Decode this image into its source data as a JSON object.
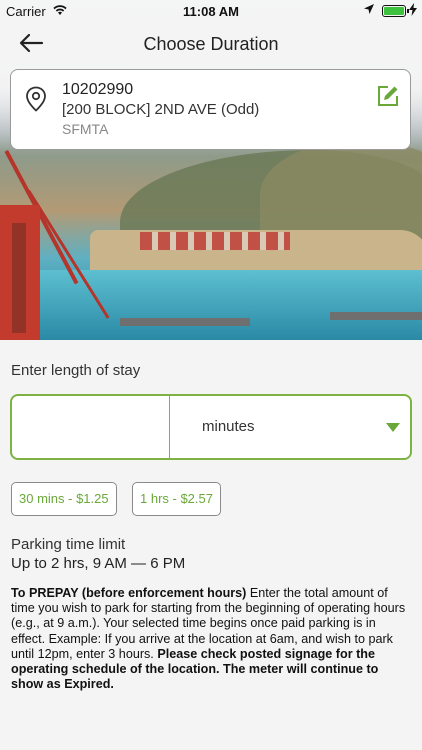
{
  "status_bar": {
    "carrier": "Carrier",
    "time": "11:08 AM",
    "battery_level": 1.0,
    "icons": [
      "wifi-icon",
      "location-arrow-icon",
      "battery-icon",
      "charging-bolt-icon"
    ]
  },
  "nav": {
    "title": "Choose Duration",
    "back_icon": "arrow-left-icon"
  },
  "location": {
    "code": "10202990",
    "address": "[200 BLOCK] 2ND AVE (Odd)",
    "agency": "SFMTA",
    "pin_icon": "map-pin-icon",
    "edit_icon": "edit-icon"
  },
  "duration": {
    "label": "Enter length of stay",
    "value": "",
    "placeholder": "",
    "unit": "minutes",
    "accent": "#7cb342"
  },
  "presets": [
    {
      "label": "30 mins - $1.25"
    },
    {
      "label": "1 hrs - $2.57"
    }
  ],
  "limit": {
    "label": "Parking time limit",
    "value": "Up to 2 hrs, 9 AM — 6 PM"
  },
  "info": {
    "lead": "To PREPAY (before enforcement hours)",
    "body": " Enter the total amount of time you wish to park for starting from the beginning of operating hours (e.g., at 9 a.m.). Your selected time begins once paid parking is in effect. Example: If you arrive at the location at 6am, and wish to park until 12pm, enter 3 hours. ",
    "tail": "Please check posted signage for the operating schedule of the location. The meter will continue to show as Expired."
  }
}
